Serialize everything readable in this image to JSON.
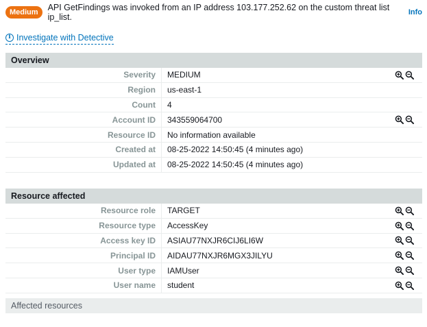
{
  "header": {
    "badge": "Medium",
    "title": "API GetFindings was invoked from an IP address 103.177.252.62 on the custom threat list ip_list.",
    "info": "Info"
  },
  "investigate": {
    "label": "Investigate with Detective"
  },
  "overview": {
    "title": "Overview",
    "rows": [
      {
        "label": "Severity",
        "value": "MEDIUM",
        "zoom": true
      },
      {
        "label": "Region",
        "value": "us-east-1",
        "zoom": false
      },
      {
        "label": "Count",
        "value": "4",
        "zoom": false
      },
      {
        "label": "Account ID",
        "value": "343559064700",
        "zoom": true
      },
      {
        "label": "Resource ID",
        "value": "No information available",
        "zoom": false
      },
      {
        "label": "Created at",
        "value": "08-25-2022 14:50:45 (4 minutes ago)",
        "zoom": false
      },
      {
        "label": "Updated at",
        "value": "08-25-2022 14:50:45 (4 minutes ago)",
        "zoom": false
      }
    ]
  },
  "resource": {
    "title": "Resource affected",
    "rows": [
      {
        "label": "Resource role",
        "value": "TARGET",
        "zoom": true
      },
      {
        "label": "Resource type",
        "value": "AccessKey",
        "zoom": true
      },
      {
        "label": "Access key ID",
        "value": "ASIAU77NXJR6CIJ6LI6W",
        "zoom": true
      },
      {
        "label": "Principal ID",
        "value": "AIDAU77NXJR6MGX3JILYU",
        "zoom": true
      },
      {
        "label": "User type",
        "value": "IAMUser",
        "zoom": true
      },
      {
        "label": "User name",
        "value": "student",
        "zoom": true
      }
    ]
  },
  "affected": {
    "label": "Affected resources"
  },
  "colors": {
    "badge": "#ec7211",
    "link": "#0073bb",
    "section_header": "#d5dbdb"
  }
}
